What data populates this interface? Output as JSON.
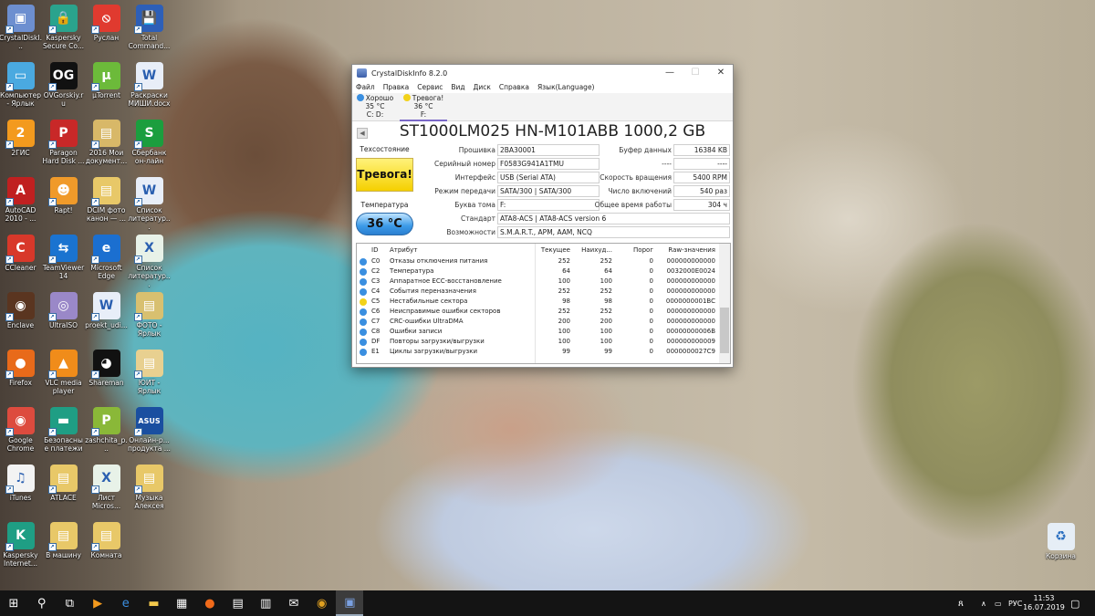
{
  "desktop": {
    "icons": [
      [
        "CrystalDiskI...",
        "#6d8fd0",
        "▣"
      ],
      [
        "Kaspersky Secure Co...",
        "#2aa38d",
        "🔒"
      ],
      [
        "Руслан",
        "#e03a2f",
        "⦸"
      ],
      [
        "Total Command...",
        "#2d5fb8",
        "💾"
      ],
      [
        "Компьютер - Ярлык",
        "#4aa9e0",
        "▭"
      ],
      [
        "OVGorskiy.ru",
        "#111",
        "OG"
      ],
      [
        "µTorrent",
        "#6cba3a",
        "µ"
      ],
      [
        "Раскраски МИШИ.docx",
        "#e8eef8",
        "W"
      ],
      [
        "2ГИС",
        "#f39a1e",
        "2"
      ],
      [
        "Paragon Hard Disk ...",
        "#c82828",
        "P"
      ],
      [
        "2016 Мои документ...",
        "#d8b868",
        "▤"
      ],
      [
        "Сбербанк он-лайн",
        "#1b9e3e",
        "S"
      ],
      [
        "AutoCAD 2010 - ...",
        "#c02020",
        "A"
      ],
      [
        "Rapt!",
        "#f09a2a",
        "☻"
      ],
      [
        "DCIM фото канон — ...",
        "#e8c868",
        "▤"
      ],
      [
        "Список литератур...",
        "#e8eef8",
        "W"
      ],
      [
        "CCleaner",
        "#d8382a",
        "C"
      ],
      [
        "TeamViewer 14",
        "#1a73d0",
        "⇆"
      ],
      [
        "Microsoft Edge",
        "#1b6fd0",
        "e"
      ],
      [
        "Список литератур...",
        "#e8f2e8",
        "X"
      ],
      [
        "Enclave",
        "#5a3520",
        "◉"
      ],
      [
        "UltraISO",
        "#9a88c8",
        "◎"
      ],
      [
        "proekt_udi...",
        "#e8eef8",
        "W"
      ],
      [
        "ФОТО - Ярлык",
        "#d8c070",
        "▤"
      ],
      [
        "Firefox",
        "#e86a1a",
        "●"
      ],
      [
        "VLC media player",
        "#f08c1a",
        "▲"
      ],
      [
        "Shareman",
        "#111",
        "◕"
      ],
      [
        "ЮИТ - Ярлык",
        "#e8d090",
        "▤"
      ],
      [
        "Google Chrome",
        "#dd4b3e",
        "◉"
      ],
      [
        "Безопасные платежи",
        "#1f9e84",
        "▬"
      ],
      [
        "zashchita_p...",
        "#8ab838",
        "P"
      ],
      [
        "Онлайн-р... продукта ...",
        "#1a4fa0",
        "ASUS"
      ],
      [
        "iTunes",
        "#f3f3f3",
        "♫"
      ],
      [
        "ATLACE",
        "#e8c868",
        "▤"
      ],
      [
        "Лист Micros...",
        "#e8f2e8",
        "X"
      ],
      [
        "Музыка Алексея",
        "#e8c868",
        "▤"
      ],
      [
        "Kaspersky Internet...",
        "#1f9e84",
        "K"
      ],
      [
        "В машину",
        "#e8c868",
        "▤"
      ],
      [
        "Комната",
        "#e8c868",
        "▤"
      ]
    ],
    "recycle_bin": "Корзина"
  },
  "window": {
    "title": "CrystalDiskInfo 8.2.0",
    "menu": [
      "Файл",
      "Правка",
      "Сервис",
      "Вид",
      "Диск",
      "Справка",
      "Язык(Language)"
    ],
    "drives": [
      {
        "status": "Хорошо",
        "temp": "35 °C",
        "letters": "C: D:",
        "color": "#3a8fe0"
      },
      {
        "status": "Тревога!",
        "temp": "36 °C",
        "letters": "F:",
        "color": "#f2d21a"
      }
    ],
    "model": "ST1000LM025 HN-M101ABB 1000,2 GB",
    "health_label": "Техсостояние",
    "health": "Тревога!",
    "temp_label": "Температура",
    "temp": "36 °C",
    "left_fields": [
      [
        "Прошивка",
        "2BA30001"
      ],
      [
        "Серийный номер",
        "F0583G941A1TMU"
      ],
      [
        "Интерфейс",
        "USB (Serial ATA)"
      ],
      [
        "Режим передачи",
        "SATA/300 | SATA/300"
      ],
      [
        "Буква тома",
        "F:"
      ]
    ],
    "right_fields": [
      [
        "Буфер данных",
        "16384 KB"
      ],
      [
        "----",
        "----"
      ],
      [
        "Скорость вращения",
        "5400 RPM"
      ],
      [
        "Число включений",
        "540 раз"
      ],
      [
        "Общее время работы",
        "304 ч"
      ]
    ],
    "wide_fields": [
      [
        "Стандарт",
        "ATA8-ACS | ATA8-ACS version 6"
      ],
      [
        "Возможности",
        "S.M.A.R.T., APM, AAM, NCQ"
      ]
    ],
    "table": {
      "headers": [
        "ID",
        "Атрибут",
        "Текущее",
        "Наихуд...",
        "Порог",
        "Raw-значения"
      ],
      "rows": [
        [
          "C0",
          "Отказы отключения питания",
          "252",
          "252",
          "0",
          "000000000000",
          "good"
        ],
        [
          "C2",
          "Температура",
          "64",
          "64",
          "0",
          "0032000E0024",
          "good"
        ],
        [
          "C3",
          "Аппаратное ECC-восстановление",
          "100",
          "100",
          "0",
          "000000000000",
          "good"
        ],
        [
          "C4",
          "События переназначения",
          "252",
          "252",
          "0",
          "000000000000",
          "good"
        ],
        [
          "C5",
          "Нестабильные сектора",
          "98",
          "98",
          "0",
          "0000000001BC",
          "warn"
        ],
        [
          "C6",
          "Неисправимые ошибки секторов",
          "252",
          "252",
          "0",
          "000000000000",
          "good"
        ],
        [
          "C7",
          "CRC-ошибки UltraDMA",
          "200",
          "200",
          "0",
          "000000000000",
          "good"
        ],
        [
          "C8",
          "Ошибки записи",
          "100",
          "100",
          "0",
          "00000000006B",
          "good"
        ],
        [
          "DF",
          "Повторы загрузки/выгрузки",
          "100",
          "100",
          "0",
          "000000000009",
          "good"
        ],
        [
          "E1",
          "Циклы загрузки/выгрузки",
          "99",
          "99",
          "0",
          "0000000027C9",
          "good"
        ]
      ]
    }
  },
  "taskbar": {
    "icons": [
      "start",
      "search",
      "task-view",
      "media",
      "edge",
      "explorer",
      "store",
      "firefox",
      "calculator",
      "scanner",
      "mail",
      "chrome",
      "crystaldiskinfo"
    ],
    "lang": "РУС",
    "time": "11:53",
    "date": "16.07.2019"
  }
}
